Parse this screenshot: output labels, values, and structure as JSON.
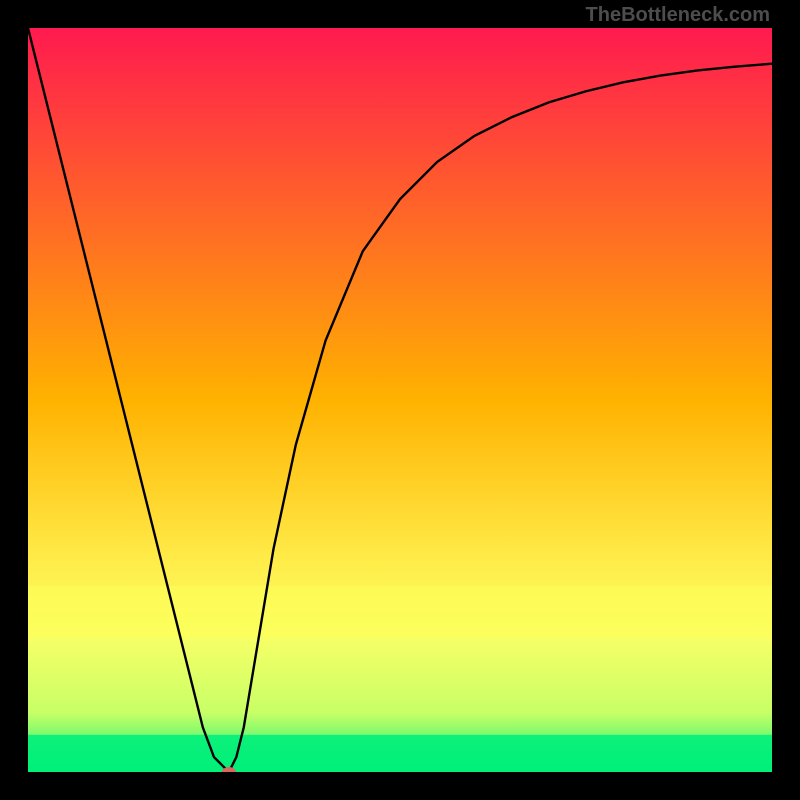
{
  "watermark": "TheBottleneck.com",
  "chart_data": {
    "type": "line",
    "title": "",
    "xlabel": "",
    "ylabel": "",
    "xlim": [
      0,
      100
    ],
    "ylim": [
      0,
      100
    ],
    "x": [
      0,
      5,
      10,
      13,
      16,
      19,
      22,
      23.5,
      25,
      26,
      27,
      28,
      29,
      30,
      33,
      36,
      40,
      45,
      50,
      55,
      60,
      65,
      70,
      75,
      80,
      85,
      90,
      95,
      100
    ],
    "y": [
      100,
      80,
      60,
      48,
      36,
      24,
      12,
      6,
      2,
      1,
      0,
      2,
      6,
      12,
      30,
      44,
      58,
      70,
      77,
      82,
      85.5,
      88,
      90,
      91.5,
      92.7,
      93.6,
      94.3,
      94.8,
      95.2
    ],
    "min_point": {
      "x": 27,
      "y": 0
    },
    "background_gradient": {
      "top": "#ff1a4f",
      "mid": "#ffdd00",
      "bottom": "#00f07a"
    },
    "yellow_band": {
      "y0": 75,
      "y1": 82
    },
    "green_band": {
      "y0": 95,
      "y1": 100
    }
  }
}
